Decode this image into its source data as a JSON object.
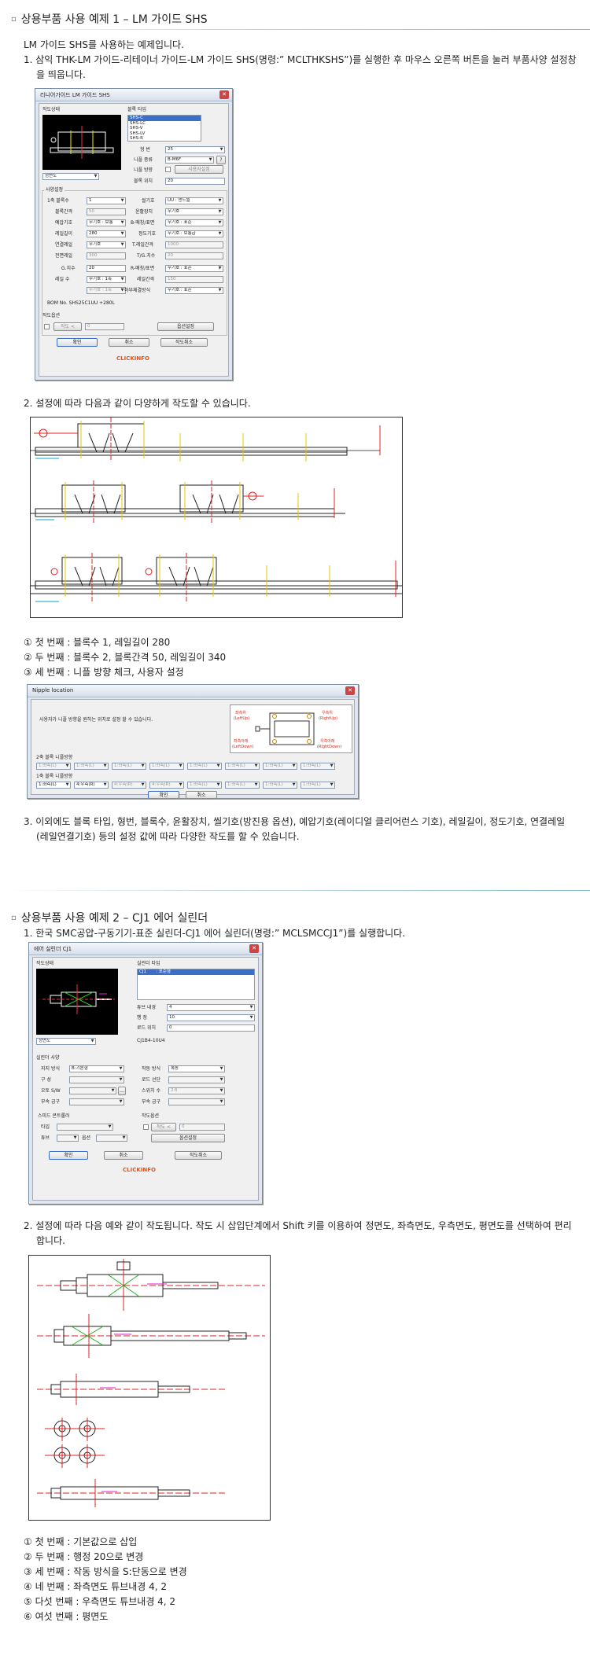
{
  "section1": {
    "title": "상용부품 사용 예제 1 – LM 가이드 SHS",
    "intro": "LM 가이드 SHS를 사용하는 예제입니다.",
    "step1": "1. 삼익 THK-LM 가이드-리테이너 가이드-LM 가이드 SHS(명령:” MCLTHKSHS”)를 실행한 후 마우스 오른쪽 버튼을 눌러 부품사양 설정창을 띄웁니다.",
    "step2": "2. 설정에 따라 다음과 같이 다양하게 작도할 수 있습니다.",
    "notes": [
      "① 첫 번째 : 블록수 1, 레일길이 280",
      "② 두 번째 : 블록수 2, 블록간격 50, 레일길이 340",
      "③ 세 번째 : 니플 방향 체크, 사용자 설정"
    ],
    "step3": "3. 이외에도 블록 타입, 형번, 블록수, 윤활장치, 씰기호(방진용 옵션), 예압기호(레이디얼 클리어런스 기호), 레일길이, 정도기호, 연결레일(레일연결기호) 등의 설정 값에 따라 다양한 작도를 할 수 있습니다."
  },
  "dialog1": {
    "title": "리니어가이드 LM 가이드 SHS",
    "preview_label": "작도상태",
    "block_type_label": "블록 타입",
    "block_types": [
      "SHS-C",
      "SHS-LC",
      "SHS-V",
      "SHS-LV",
      "SHS-R"
    ],
    "view_select": "정면도",
    "size_label": "형   번",
    "size_value": "25",
    "nipple_type_label": "니플 종류",
    "nipple_type_value": "B-M6F",
    "nipple_dir_label": "니플 방향",
    "user_setting_btn": "사용자설정",
    "block_pos_label": "블록 위치",
    "block_pos_value": "20",
    "spec_label": "사양설정",
    "left_labels": [
      "1축 블록수",
      "블록간격",
      "예압기호",
      "레일길이",
      "연결레일",
      "전면레일",
      "G.치수",
      "레일 수"
    ],
    "left_values": [
      "1",
      "50",
      "무기호 : 보통",
      "280",
      "무기호",
      "300",
      "20",
      "무기호 : 1축"
    ],
    "right_labels": [
      "씰기호",
      "윤활장치",
      "B-매칭/표면",
      "정도기호",
      "T.레일간격",
      "T/G.치수",
      "R-매칭/표면",
      "레일간격",
      "하부체결방식"
    ],
    "right_values": [
      "UU : 엔드씰",
      "무기호",
      "무기호 : 표준",
      "무기호 : 보통급",
      "1000",
      "20",
      "무기호 : 표준",
      "150",
      "무기호 : 표준"
    ],
    "extra_field": "무기호 : 1축",
    "bom": "BOM No. SHS25C1UU +280L",
    "draw_opt_label": "작도옵션",
    "draw_opt_check": "작도 <",
    "draw_opt_value": "0",
    "opt_btn": "옵션설정",
    "ok_btn": "확인",
    "cancel_btn": "취소",
    "draw_cancel_btn": "작도취소",
    "logo": "CLICKINFO"
  },
  "nipple_dialog": {
    "title": "Nipple location",
    "desc": "사용자가 니플 방향을 원하는 위치로 설정 할 수 있습니다.",
    "row2_label": "2축 블록 니플방향",
    "row1_label": "1축 블록 니플방향",
    "opt": "1:좌측(L)",
    "opt_a": "1:좌측(L)",
    "opt_b": "4:우측(R)",
    "diag_labels": [
      "좌측위",
      "(LeftUp)",
      "우측위",
      "(RightUp)",
      "좌측아래",
      "(LeftDown)",
      "우측아래",
      "(RightDown)"
    ],
    "ok": "확인",
    "cancel": "취소"
  },
  "section2": {
    "title": "상용부품 사용 예제 2 – CJ1 에어 실린더",
    "step1": "1. 한국 SMC공압-구동기기-표준 실린더-CJ1 에어 실린더(명령:” MCLSMCCJ1”)를 실행합니다.",
    "step2": "2. 설정에 따라 다음 예와 같이 작도됩니다. 작도 시 삽입단계에서 Shift 키를 이용하여 정면도, 좌측면도, 우측면도, 평면도를 선택하여 편리합니다.",
    "notes": [
      "① 첫 번째 : 기본값으로 삽입",
      "② 두 번째 : 행정 20으로 변경",
      "③ 세 번째 : 작동 방식을 S:단동으로 변경",
      "④ 네 번째 : 좌측면도 튜브내경 4, 2",
      "⑤ 다섯 번째 : 우측면도 튜브내경 4, 2",
      "⑥ 여섯 번째 : 평면도"
    ]
  },
  "dialog2": {
    "title": "에어 실린더 CJ1",
    "preview_label": "작도상태",
    "type_label": "실린더 타입",
    "type_value": "CJ1       : 표준형",
    "bore_label": "튜브 내경",
    "bore_value": "4",
    "stroke_label": "행   정",
    "stroke_value": "10",
    "rod_label": "로드 위치",
    "rod_value": "0",
    "model": "CJ1B4-10U4",
    "view_select": "정면도",
    "spec_label": "실린더 사양",
    "mount_label": "지지 방식",
    "mount_value": "B:기본형",
    "act_label": "작동 방식",
    "act_value": "복동",
    "l2_label": "구   성",
    "rod_end_label": "로드 선단",
    "sw_label": "오토 S/W",
    "sw_count_label": "스위치 수",
    "sw_count_value": "2개",
    "acc_label": "부속 금구",
    "acc2_label": "부속 금구",
    "speed_label": "스피드 콘트롤러",
    "speed_type": "타입",
    "tube_label": "튜브",
    "opt_label": "옵션",
    "draw_opt_label": "작도옵션",
    "draw_opt_check": "작도 <",
    "draw_opt_value": "0",
    "opt_btn": "옵션설정",
    "ok_btn": "확인",
    "cancel_btn": "취소",
    "draw_cancel_btn": "작도취소",
    "logo": "CLICKINFO"
  },
  "colors": {
    "accent": "#d52b1e",
    "cad_yellow": "#e8c400",
    "cad_red": "#e02020",
    "cad_cyan": "#00a8c8",
    "cad_magenta": "#d020d0",
    "cad_green": "#20b020"
  }
}
